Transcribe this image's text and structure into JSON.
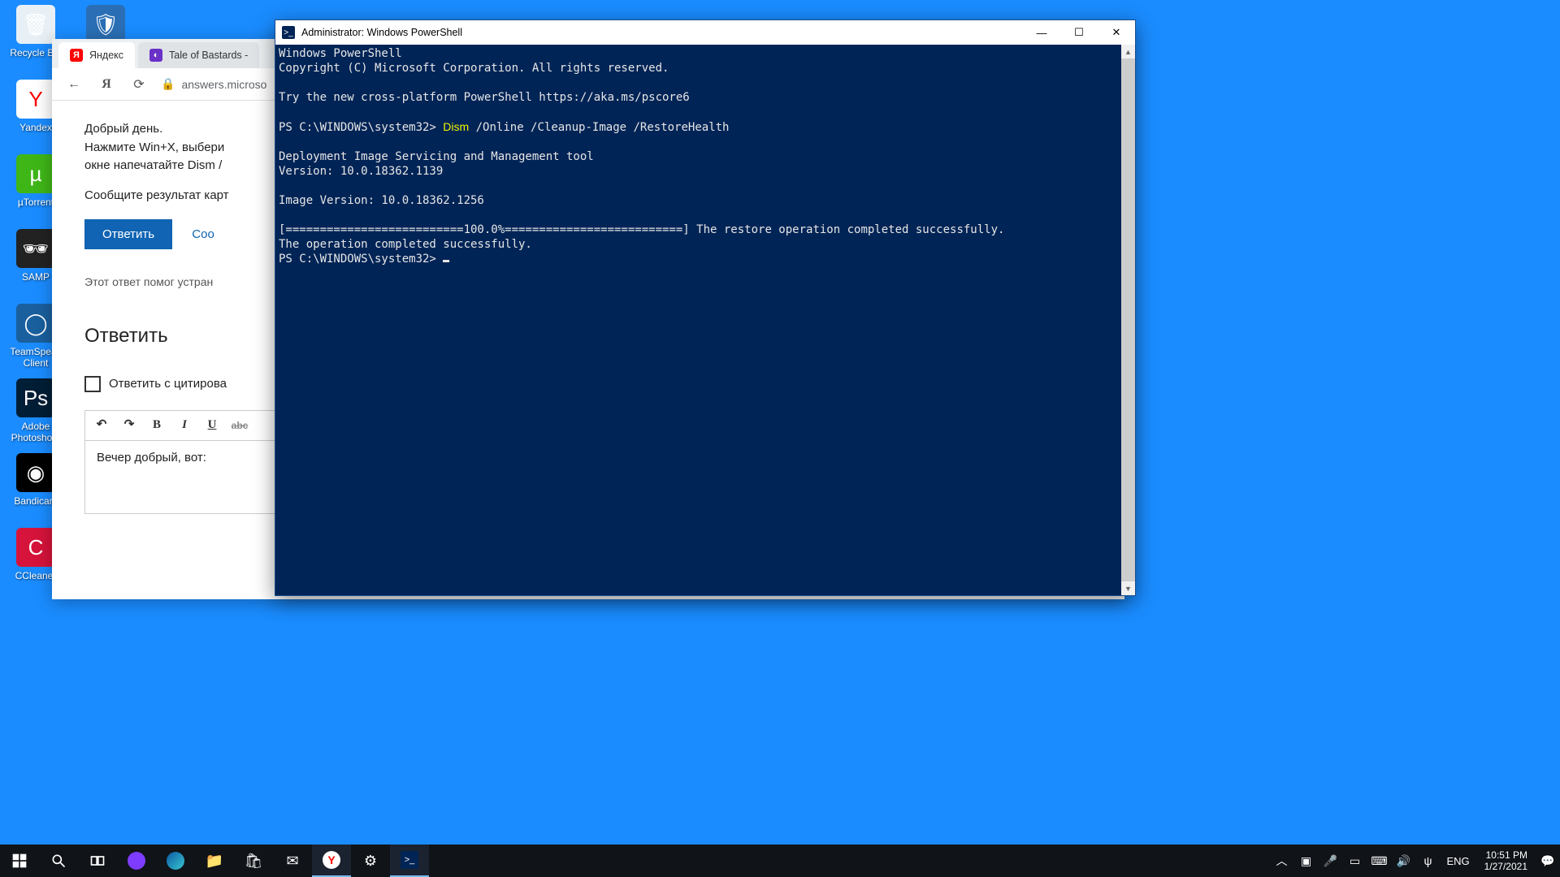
{
  "desktop": {
    "icons": [
      {
        "label": "Recycle Bin",
        "color": "#e8f0f5",
        "glyph": "🗑"
      },
      {
        "label": "Yandex",
        "color": "#fff",
        "glyph": "Y"
      },
      {
        "label": "µTorrent",
        "color": "#3fb618",
        "glyph": "µ"
      },
      {
        "label": "SAMP",
        "color": "#222",
        "glyph": "🕶"
      },
      {
        "label": "TeamSpeak Client",
        "color": "#1a5f9e",
        "glyph": "◯"
      },
      {
        "label": "Adobe Photosho...",
        "color": "#001e36",
        "glyph": "Ps"
      },
      {
        "label": "Bandicam",
        "color": "#000",
        "glyph": "◉"
      },
      {
        "label": "CCleaner",
        "color": "#d6133b",
        "glyph": "C"
      }
    ],
    "top_right_icon": {
      "label": "",
      "glyph": "🛡",
      "color": "#2a6fb5"
    }
  },
  "browser": {
    "tabs": [
      {
        "label": "Яндекс",
        "favicon": "#ff0000",
        "txt": "Я",
        "active": true
      },
      {
        "label": "Tale of Bastards -",
        "favicon": "#6a31c7",
        "txt": "◐",
        "active": false
      }
    ],
    "url": "answers.microso",
    "greeting": "Добрый день.",
    "line2": "Нажмите Win+X, выбери",
    "line3": "окне напечатайте Dism /",
    "line4": "Сообщите результат карт",
    "reply_btn": "Ответить",
    "report_link": "Соо",
    "feedback": "Этот ответ помог устран",
    "answer_heading": "Ответить",
    "quote_label": "Ответить с цитирова",
    "editor_text": "Вечер добрый, вот:"
  },
  "powershell": {
    "title": "Administrator: Windows PowerShell",
    "lines": [
      {
        "t": "Windows PowerShell"
      },
      {
        "t": "Copyright (C) Microsoft Corporation. All rights reserved."
      },
      {
        "t": ""
      },
      {
        "t": "Try the new cross-platform PowerShell https://aka.ms/pscore6"
      },
      {
        "t": ""
      },
      {
        "prompt": "PS C:\\WINDOWS\\system32> ",
        "cmd": "Dism",
        "rest": " /Online /Cleanup-Image /RestoreHealth"
      },
      {
        "t": ""
      },
      {
        "t": "Deployment Image Servicing and Management tool"
      },
      {
        "t": "Version: 10.0.18362.1139"
      },
      {
        "t": ""
      },
      {
        "t": "Image Version: 10.0.18362.1256"
      },
      {
        "t": ""
      },
      {
        "t": "[==========================100.0%==========================] The restore operation completed successfully."
      },
      {
        "t": "The operation completed successfully."
      },
      {
        "prompt": "PS C:\\WINDOWS\\system32> ",
        "cursor": true
      }
    ]
  },
  "taskbar": {
    "apps": [
      "start",
      "search",
      "taskview",
      "yandex-alice",
      "edge",
      "explorer",
      "store",
      "mail",
      "yandex-browser",
      "settings",
      "powershell"
    ],
    "tray": [
      "chevron",
      "security",
      "mic",
      "battery",
      "keyboard",
      "volume",
      "usb"
    ],
    "lang": "ENG",
    "time": "10:51 PM",
    "date": "1/27/2021"
  }
}
